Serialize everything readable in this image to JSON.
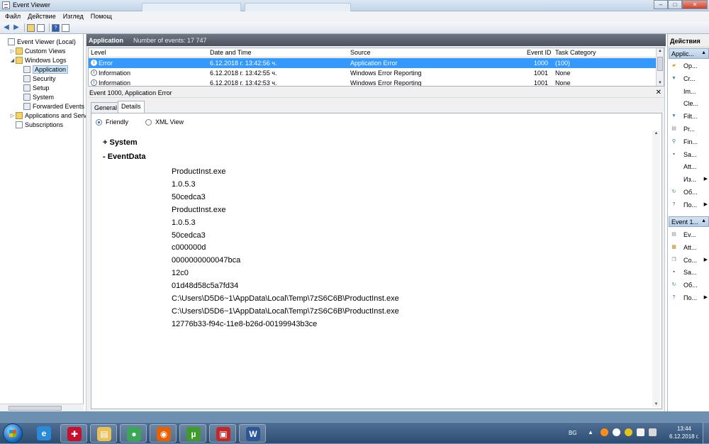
{
  "window": {
    "title": "Event Viewer",
    "controls": {
      "minimize": "–",
      "maximize": "□",
      "close": "✕"
    }
  },
  "menu": [
    "Файл",
    "Действие",
    "Изглед",
    "Помощ"
  ],
  "tree": {
    "items": [
      {
        "label": "Event Viewer (Local)",
        "icon": "event-viewer-icon",
        "indent": 0,
        "expander": ""
      },
      {
        "label": "Custom Views",
        "icon": "folder-icon",
        "indent": 1,
        "expander": "▷"
      },
      {
        "label": "Windows Logs",
        "icon": "folder-icon",
        "indent": 1,
        "expander": "◢"
      },
      {
        "label": "Application",
        "icon": "log-icon",
        "indent": 2,
        "expander": "",
        "selected": true
      },
      {
        "label": "Security",
        "icon": "log-icon",
        "indent": 2,
        "expander": ""
      },
      {
        "label": "Setup",
        "icon": "log-icon",
        "indent": 2,
        "expander": ""
      },
      {
        "label": "System",
        "icon": "log-icon",
        "indent": 2,
        "expander": ""
      },
      {
        "label": "Forwarded Events",
        "icon": "log-icon",
        "indent": 2,
        "expander": ""
      },
      {
        "label": "Applications and Servi",
        "icon": "folder-icon",
        "indent": 1,
        "expander": "▷"
      },
      {
        "label": "Subscriptions",
        "icon": "subscriptions-icon",
        "indent": 1,
        "expander": ""
      }
    ]
  },
  "log": {
    "name": "Application",
    "count": "Number of events: 17 747",
    "columns": [
      "Level",
      "Date and Time",
      "Source",
      "Event ID",
      "Task Category"
    ],
    "rows": [
      {
        "level": "Error",
        "date": "6.12.2018 г. 13:42:56 ч.",
        "source": "Application Error",
        "event_id": "1000",
        "task": "(100)",
        "selected": true
      },
      {
        "level": "Information",
        "date": "6.12.2018 г. 13:42:55 ч.",
        "source": "Windows Error Reporting",
        "event_id": "1001",
        "task": "None"
      },
      {
        "level": "Information",
        "date": "6.12.2018 г. 13:42:53 ч.",
        "source": "Windows Error Reporting",
        "event_id": "1001",
        "task": "None"
      }
    ]
  },
  "details": {
    "title": "Event 1000, Application Error",
    "close": "✕",
    "tabs": [
      "General",
      "Details"
    ],
    "active_tab": "Details",
    "view_friendly": "Friendly",
    "view_xml": "XML View",
    "system_label": "+ System",
    "eventdata_label": "-  EventData",
    "event_data": [
      "ProductInst.exe",
      "1.0.5.3",
      "50cedca3",
      "ProductInst.exe",
      "1.0.5.3",
      "50cedca3",
      "c000000d",
      "0000000000047bca",
      "12c0",
      "01d48d58c5a7fd34",
      "C:\\Users\\D5D6~1\\AppData\\Local\\Temp\\7zS6C6B\\ProductInst.exe",
      "C:\\Users\\D5D6~1\\AppData\\Local\\Temp\\7zS6C6B\\ProductInst.exe",
      "12776b33-f94c-11e8-b26d-00199943b3ce"
    ]
  },
  "actions": {
    "title": "Действия",
    "section1": "Applic...",
    "items1": [
      {
        "label": "Op...",
        "icon": "open-icon",
        "submenu": false
      },
      {
        "label": "Cr...",
        "icon": "filter-icon",
        "submenu": false
      },
      {
        "label": "Im...",
        "icon": "blank-icon",
        "submenu": false
      },
      {
        "label": "Cle...",
        "icon": "blank-icon",
        "submenu": false
      },
      {
        "label": "Filt...",
        "icon": "filter-icon",
        "submenu": false
      },
      {
        "label": "Pr...",
        "icon": "properties-icon",
        "submenu": false
      },
      {
        "label": "Fin...",
        "icon": "find-icon",
        "submenu": false
      },
      {
        "label": "Sa...",
        "icon": "save-icon",
        "submenu": false
      },
      {
        "label": "Att...",
        "icon": "blank-icon",
        "submenu": false
      },
      {
        "label": "Из...",
        "icon": "blank-icon",
        "submenu": true
      },
      {
        "label": "Об...",
        "icon": "refresh-icon",
        "submenu": false
      },
      {
        "label": "По...",
        "icon": "help-icon",
        "submenu": true
      }
    ],
    "section2": "Event 1...",
    "items2": [
      {
        "label": "Ev...",
        "icon": "event-properties-icon",
        "submenu": false
      },
      {
        "label": "Att...",
        "icon": "attach-task-icon",
        "submenu": false
      },
      {
        "label": "Co...",
        "icon": "copy-icon",
        "submenu": true
      },
      {
        "label": "Sa...",
        "icon": "save-icon",
        "submenu": false
      },
      {
        "label": "Об...",
        "icon": "refresh-icon",
        "submenu": false
      },
      {
        "label": "По...",
        "icon": "help-icon",
        "submenu": true
      }
    ]
  },
  "taskbar": {
    "apps": [
      {
        "name": "internet-explorer",
        "glyph": "e",
        "color": "#2a8ad8"
      },
      {
        "name": "language-flag",
        "glyph": "✚",
        "color": "#c8102e"
      },
      {
        "name": "file-explorer",
        "glyph": "▤",
        "color": "#e8c15a"
      },
      {
        "name": "chrome",
        "glyph": "●",
        "color": "#3aa757"
      },
      {
        "name": "firefox",
        "glyph": "◉",
        "color": "#e66000"
      },
      {
        "name": "utorrent",
        "glyph": "µ",
        "color": "#3f9b2c"
      },
      {
        "name": "toolbox",
        "glyph": "▣",
        "color": "#c0282a"
      },
      {
        "name": "word",
        "glyph": "W",
        "color": "#2b5797"
      }
    ],
    "tray_lang": "BG",
    "tray_up": "▲",
    "time": "13:44",
    "date": "6.12.2018 г."
  }
}
